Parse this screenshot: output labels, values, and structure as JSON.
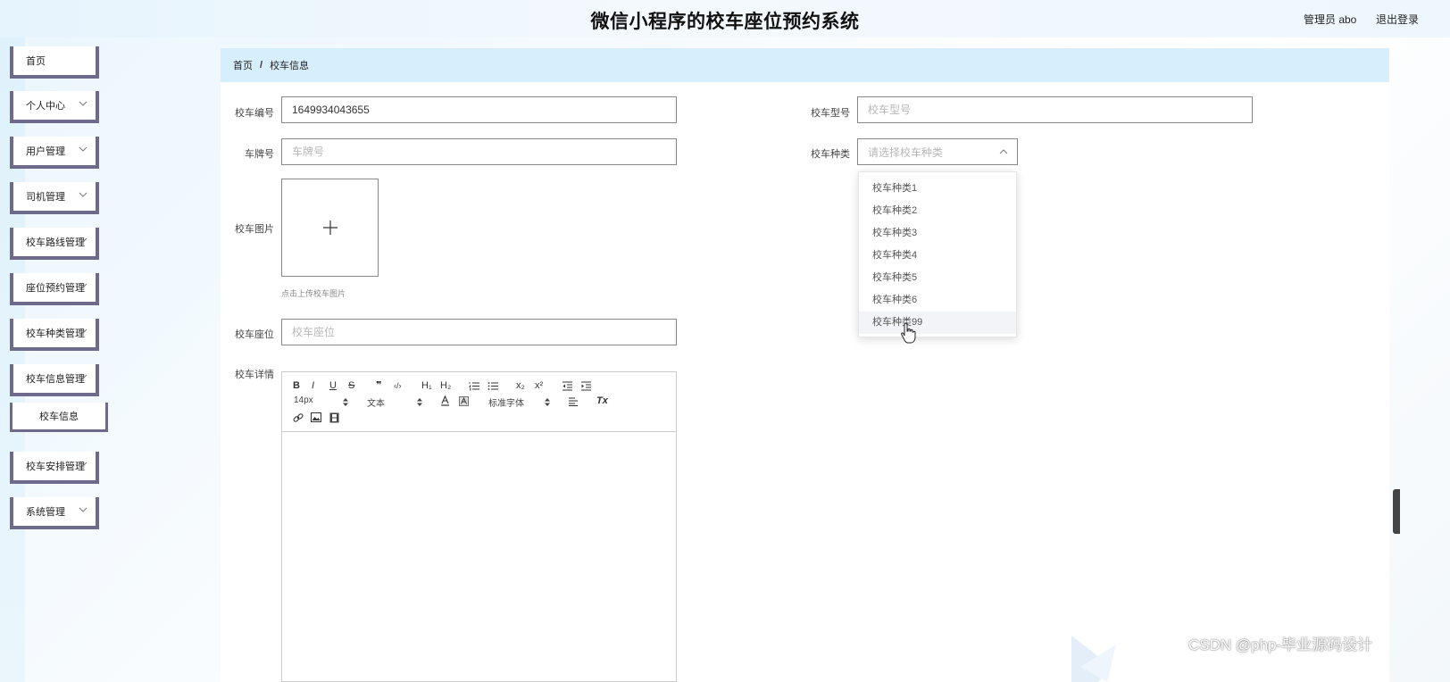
{
  "header": {
    "title": "微信小程序的校车座位预约系统",
    "admin_label": "管理员 abo",
    "logout_label": "退出登录"
  },
  "sidebar": {
    "items": [
      {
        "label": "首页",
        "has_submenu": false
      },
      {
        "label": "个人中心",
        "has_submenu": true
      },
      {
        "label": "用户管理",
        "has_submenu": true
      },
      {
        "label": "司机管理",
        "has_submenu": true
      },
      {
        "label": "校车路线管理",
        "has_submenu": true
      },
      {
        "label": "座位预约管理",
        "has_submenu": true
      },
      {
        "label": "校车种类管理",
        "has_submenu": true
      },
      {
        "label": "校车信息管理",
        "has_submenu": true
      },
      {
        "label": "校车安排管理",
        "has_submenu": true
      },
      {
        "label": "系统管理",
        "has_submenu": true
      }
    ],
    "submenu": {
      "label": "校车信息"
    }
  },
  "breadcrumb": {
    "home": "首页",
    "separator": "/",
    "current": "校车信息"
  },
  "form": {
    "bus_number": {
      "label": "校车编号",
      "value": "1649934043655"
    },
    "bus_model": {
      "label": "校车型号",
      "placeholder": "校车型号"
    },
    "plate_number": {
      "label": "车牌号",
      "placeholder": "车牌号"
    },
    "bus_type": {
      "label": "校车种类",
      "placeholder": "请选择校车种类"
    },
    "bus_image": {
      "label": "校车图片",
      "hint": "点击上传校车图片"
    },
    "bus_seats": {
      "label": "校车座位",
      "placeholder": "校车座位"
    },
    "bus_details": {
      "label": "校车详情"
    }
  },
  "dropdown": {
    "options": [
      "校车种类1",
      "校车种类2",
      "校车种类3",
      "校车种类4",
      "校车种类5",
      "校车种类6",
      "校车种类99"
    ],
    "hovered_index": 6
  },
  "editor": {
    "bold": "B",
    "italic": "I",
    "underline": "U",
    "strike": "S",
    "quote": "❞",
    "code": "‹/›",
    "h1": "H₁",
    "h2": "H₂",
    "sub": "x₂",
    "sup": "x²",
    "font_size": "14px",
    "text_style": "文本",
    "font_family": "标准字体",
    "clear_format": "Tx"
  },
  "watermark": "CSDN @php-毕业源码设计",
  "colors": {
    "accent": "#d7eefd",
    "menu_border": "#6d6a8c"
  }
}
